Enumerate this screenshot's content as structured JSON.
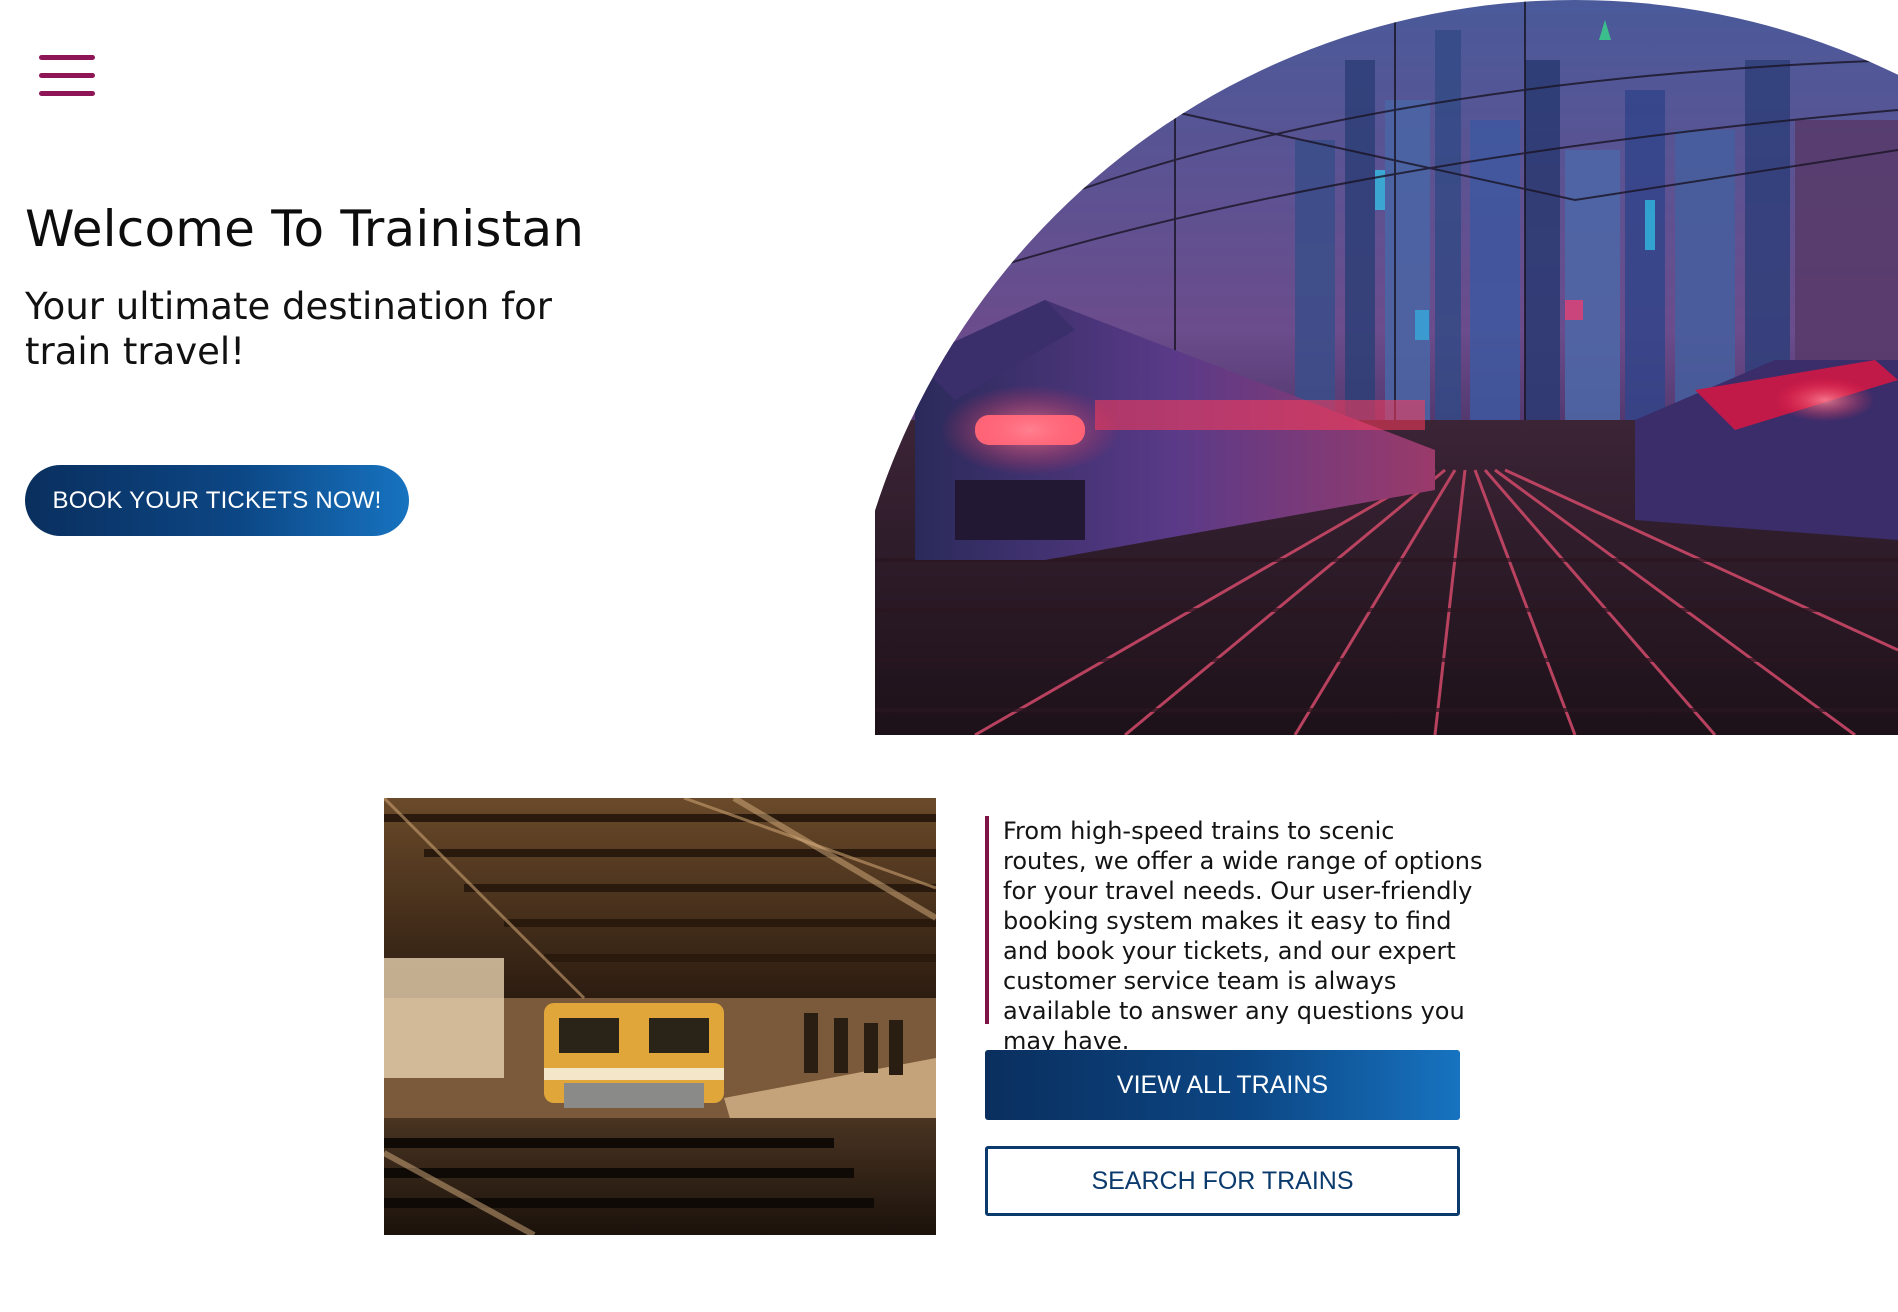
{
  "nav": {
    "menu_icon": "hamburger-menu-icon"
  },
  "hero": {
    "title": "Welcome To Trainistan",
    "subtitle": "Your ultimate destination for train travel!",
    "cta_label": "BOOK YOUR TICKETS NOW!",
    "image": "neon-city-trains-illustration"
  },
  "about": {
    "image": "train-station-platform-photo",
    "description": "From high-speed trains to scenic routes, we offer a wide range of options for your travel needs. Our user-friendly booking system makes it easy to find and book your tickets, and our expert customer service team is always available to answer any questions you may have.",
    "view_all_label": "VIEW ALL TRAINS",
    "search_label": "SEARCH FOR TRAINS"
  },
  "colors": {
    "accent": "#8e1656",
    "primary_blue": "#0c4684",
    "primary_blue_light": "#1773c0",
    "quote_border": "#7c1546"
  }
}
